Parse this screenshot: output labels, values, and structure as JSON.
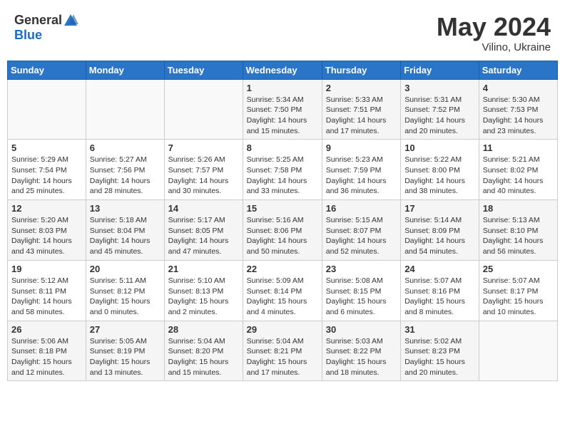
{
  "header": {
    "logo_general": "General",
    "logo_blue": "Blue",
    "month": "May 2024",
    "location": "Vilino, Ukraine"
  },
  "weekdays": [
    "Sunday",
    "Monday",
    "Tuesday",
    "Wednesday",
    "Thursday",
    "Friday",
    "Saturday"
  ],
  "weeks": [
    [
      {
        "day": "",
        "sunrise": "",
        "sunset": "",
        "daylight": ""
      },
      {
        "day": "",
        "sunrise": "",
        "sunset": "",
        "daylight": ""
      },
      {
        "day": "",
        "sunrise": "",
        "sunset": "",
        "daylight": ""
      },
      {
        "day": "1",
        "sunrise": "Sunrise: 5:34 AM",
        "sunset": "Sunset: 7:50 PM",
        "daylight": "Daylight: 14 hours and 15 minutes."
      },
      {
        "day": "2",
        "sunrise": "Sunrise: 5:33 AM",
        "sunset": "Sunset: 7:51 PM",
        "daylight": "Daylight: 14 hours and 17 minutes."
      },
      {
        "day": "3",
        "sunrise": "Sunrise: 5:31 AM",
        "sunset": "Sunset: 7:52 PM",
        "daylight": "Daylight: 14 hours and 20 minutes."
      },
      {
        "day": "4",
        "sunrise": "Sunrise: 5:30 AM",
        "sunset": "Sunset: 7:53 PM",
        "daylight": "Daylight: 14 hours and 23 minutes."
      }
    ],
    [
      {
        "day": "5",
        "sunrise": "Sunrise: 5:29 AM",
        "sunset": "Sunset: 7:54 PM",
        "daylight": "Daylight: 14 hours and 25 minutes."
      },
      {
        "day": "6",
        "sunrise": "Sunrise: 5:27 AM",
        "sunset": "Sunset: 7:56 PM",
        "daylight": "Daylight: 14 hours and 28 minutes."
      },
      {
        "day": "7",
        "sunrise": "Sunrise: 5:26 AM",
        "sunset": "Sunset: 7:57 PM",
        "daylight": "Daylight: 14 hours and 30 minutes."
      },
      {
        "day": "8",
        "sunrise": "Sunrise: 5:25 AM",
        "sunset": "Sunset: 7:58 PM",
        "daylight": "Daylight: 14 hours and 33 minutes."
      },
      {
        "day": "9",
        "sunrise": "Sunrise: 5:23 AM",
        "sunset": "Sunset: 7:59 PM",
        "daylight": "Daylight: 14 hours and 36 minutes."
      },
      {
        "day": "10",
        "sunrise": "Sunrise: 5:22 AM",
        "sunset": "Sunset: 8:00 PM",
        "daylight": "Daylight: 14 hours and 38 minutes."
      },
      {
        "day": "11",
        "sunrise": "Sunrise: 5:21 AM",
        "sunset": "Sunset: 8:02 PM",
        "daylight": "Daylight: 14 hours and 40 minutes."
      }
    ],
    [
      {
        "day": "12",
        "sunrise": "Sunrise: 5:20 AM",
        "sunset": "Sunset: 8:03 PM",
        "daylight": "Daylight: 14 hours and 43 minutes."
      },
      {
        "day": "13",
        "sunrise": "Sunrise: 5:18 AM",
        "sunset": "Sunset: 8:04 PM",
        "daylight": "Daylight: 14 hours and 45 minutes."
      },
      {
        "day": "14",
        "sunrise": "Sunrise: 5:17 AM",
        "sunset": "Sunset: 8:05 PM",
        "daylight": "Daylight: 14 hours and 47 minutes."
      },
      {
        "day": "15",
        "sunrise": "Sunrise: 5:16 AM",
        "sunset": "Sunset: 8:06 PM",
        "daylight": "Daylight: 14 hours and 50 minutes."
      },
      {
        "day": "16",
        "sunrise": "Sunrise: 5:15 AM",
        "sunset": "Sunset: 8:07 PM",
        "daylight": "Daylight: 14 hours and 52 minutes."
      },
      {
        "day": "17",
        "sunrise": "Sunrise: 5:14 AM",
        "sunset": "Sunset: 8:09 PM",
        "daylight": "Daylight: 14 hours and 54 minutes."
      },
      {
        "day": "18",
        "sunrise": "Sunrise: 5:13 AM",
        "sunset": "Sunset: 8:10 PM",
        "daylight": "Daylight: 14 hours and 56 minutes."
      }
    ],
    [
      {
        "day": "19",
        "sunrise": "Sunrise: 5:12 AM",
        "sunset": "Sunset: 8:11 PM",
        "daylight": "Daylight: 14 hours and 58 minutes."
      },
      {
        "day": "20",
        "sunrise": "Sunrise: 5:11 AM",
        "sunset": "Sunset: 8:12 PM",
        "daylight": "Daylight: 15 hours and 0 minutes."
      },
      {
        "day": "21",
        "sunrise": "Sunrise: 5:10 AM",
        "sunset": "Sunset: 8:13 PM",
        "daylight": "Daylight: 15 hours and 2 minutes."
      },
      {
        "day": "22",
        "sunrise": "Sunrise: 5:09 AM",
        "sunset": "Sunset: 8:14 PM",
        "daylight": "Daylight: 15 hours and 4 minutes."
      },
      {
        "day": "23",
        "sunrise": "Sunrise: 5:08 AM",
        "sunset": "Sunset: 8:15 PM",
        "daylight": "Daylight: 15 hours and 6 minutes."
      },
      {
        "day": "24",
        "sunrise": "Sunrise: 5:07 AM",
        "sunset": "Sunset: 8:16 PM",
        "daylight": "Daylight: 15 hours and 8 minutes."
      },
      {
        "day": "25",
        "sunrise": "Sunrise: 5:07 AM",
        "sunset": "Sunset: 8:17 PM",
        "daylight": "Daylight: 15 hours and 10 minutes."
      }
    ],
    [
      {
        "day": "26",
        "sunrise": "Sunrise: 5:06 AM",
        "sunset": "Sunset: 8:18 PM",
        "daylight": "Daylight: 15 hours and 12 minutes."
      },
      {
        "day": "27",
        "sunrise": "Sunrise: 5:05 AM",
        "sunset": "Sunset: 8:19 PM",
        "daylight": "Daylight: 15 hours and 13 minutes."
      },
      {
        "day": "28",
        "sunrise": "Sunrise: 5:04 AM",
        "sunset": "Sunset: 8:20 PM",
        "daylight": "Daylight: 15 hours and 15 minutes."
      },
      {
        "day": "29",
        "sunrise": "Sunrise: 5:04 AM",
        "sunset": "Sunset: 8:21 PM",
        "daylight": "Daylight: 15 hours and 17 minutes."
      },
      {
        "day": "30",
        "sunrise": "Sunrise: 5:03 AM",
        "sunset": "Sunset: 8:22 PM",
        "daylight": "Daylight: 15 hours and 18 minutes."
      },
      {
        "day": "31",
        "sunrise": "Sunrise: 5:02 AM",
        "sunset": "Sunset: 8:23 PM",
        "daylight": "Daylight: 15 hours and 20 minutes."
      },
      {
        "day": "",
        "sunrise": "",
        "sunset": "",
        "daylight": ""
      }
    ]
  ]
}
